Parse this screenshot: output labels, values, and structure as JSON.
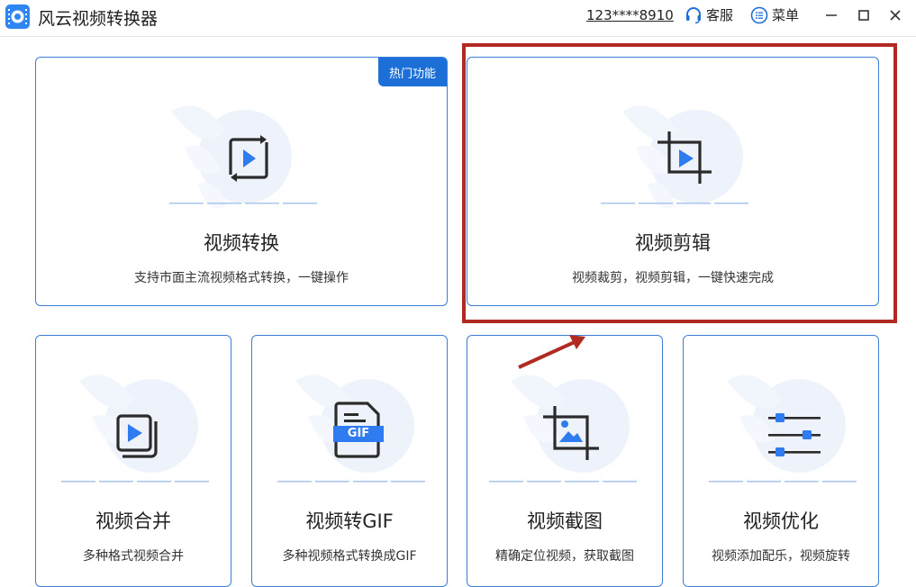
{
  "window": {
    "title": "风云视频转换器",
    "account": "123****8910",
    "support_label": "客服",
    "menu_label": "菜单"
  },
  "cards": [
    {
      "title": "视频转换",
      "desc": "支持市面主流视频格式转换，一键操作",
      "badge": "热门功能"
    },
    {
      "title": "视频剪辑",
      "desc": "视频裁剪，视频剪辑，一键快速完成"
    },
    {
      "title": "视频合并",
      "desc": "多种格式视频合并"
    },
    {
      "title": "视频转GIF",
      "desc": "多种视频格式转换成GIF",
      "icon_text": "GIF"
    },
    {
      "title": "视频截图",
      "desc": "精确定位视频，获取截图"
    },
    {
      "title": "视频优化",
      "desc": "视频添加配乐，视频旋转"
    }
  ],
  "colors": {
    "accent": "#3b7ed8",
    "badge": "#1b6fd6",
    "highlight": "#b02a22",
    "icon_dark": "#2b2b2b",
    "icon_blue": "#2f7bf0"
  }
}
